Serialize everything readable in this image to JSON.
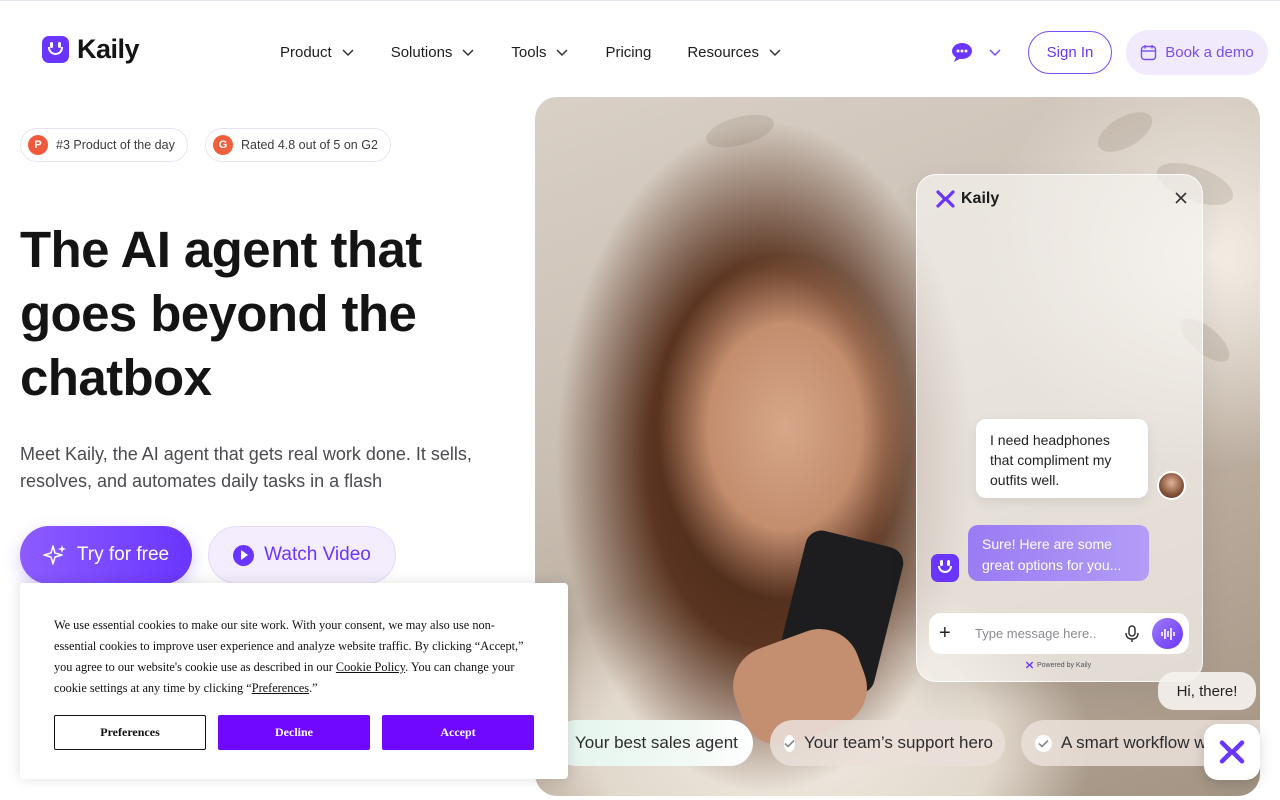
{
  "brand": {
    "name": "Kaily",
    "accent": "#6a35ff"
  },
  "nav": {
    "items": [
      {
        "label": "Product",
        "has_dropdown": true
      },
      {
        "label": "Solutions",
        "has_dropdown": true
      },
      {
        "label": "Tools",
        "has_dropdown": true
      },
      {
        "label": "Pricing",
        "has_dropdown": false
      },
      {
        "label": "Resources",
        "has_dropdown": true
      }
    ],
    "lang_icon": "chat-bubble-icon",
    "signin_label": "Sign In",
    "demo_label": "Book a demo"
  },
  "badges": [
    {
      "icon": "producthunt-icon",
      "letter": "P",
      "label": "#3 Product of the day",
      "color": "#ef5a3c"
    },
    {
      "icon": "g2-icon",
      "letter": "G",
      "label": "Rated 4.8 out of 5 on G2",
      "color": "#f0603f"
    }
  ],
  "hero": {
    "headline": "The AI agent that goes beyond the chatbox",
    "subtext": "Meet Kaily, the AI agent that gets real work done. It sells, resolves, and automates daily tasks in a flash",
    "try_label": "Try for free",
    "video_label": "Watch Video"
  },
  "chat_widget": {
    "title": "Kaily",
    "user_message": "I need headphones that compliment my outfits well.",
    "bot_message": "Sure! Here are some great options for you...",
    "input_placeholder": "Type message here..",
    "powered_by": "Powered by Kaily",
    "greeting": "Hi, there!"
  },
  "pills": [
    {
      "label": "Your best sales agent",
      "color": "#ffffff"
    },
    {
      "label": "Your team’s support hero",
      "color": "#e9dfd8"
    },
    {
      "label": "A smart workflow w",
      "color": "#e9dfd8"
    }
  ],
  "cookie": {
    "text_1": "We use essential cookies to make our site work. With your consent, we may also use non-essential cookies to improve user experience and analyze website traffic. By clicking “Accept,” you agree to our website's cookie use as described in our ",
    "policy_link": "Cookie Policy",
    "text_2": ". You can change your cookie settings at any time by clicking “",
    "pref_link": "Preferences",
    "text_3": ".”",
    "preferences_label": "Preferences",
    "decline_label": "Decline",
    "accept_label": "Accept",
    "button_color": "#7008ff"
  }
}
